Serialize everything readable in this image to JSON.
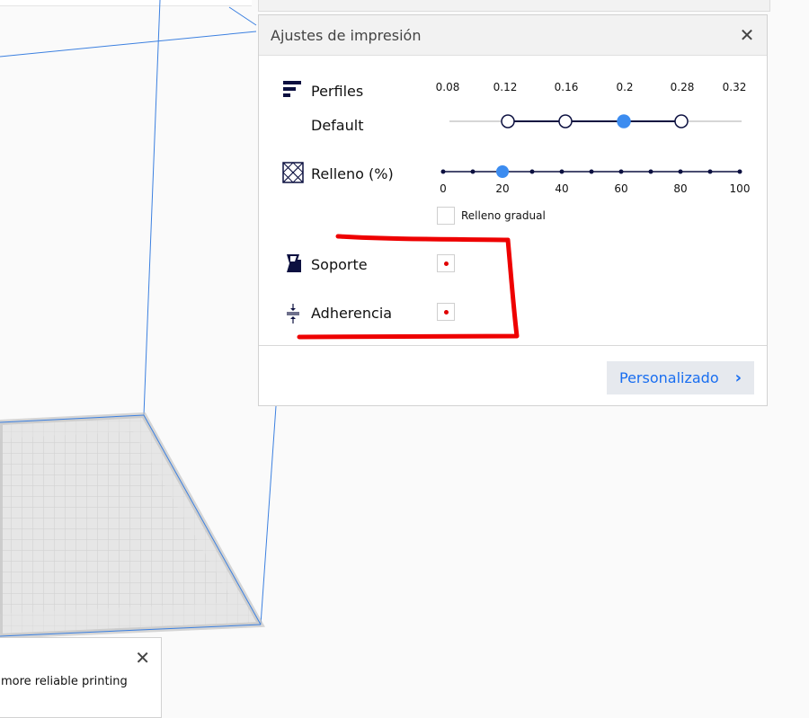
{
  "panel": {
    "title": "Ajustes de impresión",
    "close_icon": "close-icon",
    "profiles": {
      "label": "Perfiles",
      "sub_label": "Default",
      "icon": "profiles-icon",
      "layer_heights": [
        "0.08",
        "0.12",
        "0.16",
        "0.2",
        "0.28",
        "0.32"
      ],
      "available": [
        "0.12",
        "0.16",
        "0.2",
        "0.28"
      ],
      "selected": "0.2"
    },
    "infill": {
      "label": "Relleno (%)",
      "icon": "infill-icon",
      "ticks": [
        "0",
        "20",
        "40",
        "60",
        "80",
        "100"
      ],
      "value": 20,
      "gradual_label": "Relleno gradual",
      "gradual_checked": false
    },
    "support": {
      "label": "Soporte",
      "icon": "support-icon",
      "checked": true
    },
    "adhesion": {
      "label": "Adherencia",
      "icon": "adhesion-icon",
      "checked": true
    },
    "custom_button": "Personalizado",
    "custom_chevron": "chevron-right-icon"
  },
  "toast": {
    "text": "more reliable printing",
    "close_icon": "close-icon"
  },
  "colors": {
    "accent": "#3c8cf0",
    "slider_dark": "#0c1040",
    "annotation_red": "#ee0000",
    "build_volume_line": "#3c80e0"
  }
}
